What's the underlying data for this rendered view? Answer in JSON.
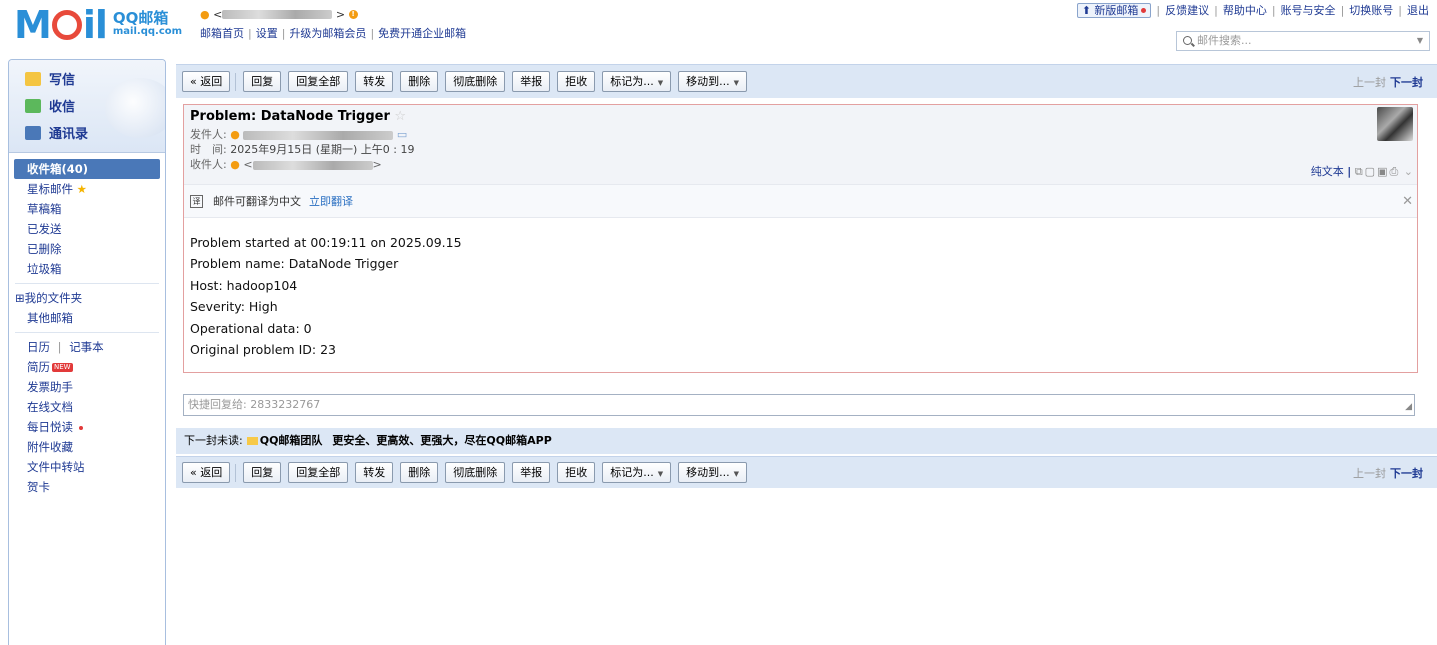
{
  "header": {
    "logo_text": "M",
    "logo_text2": "il",
    "brand_cn": "QQ邮箱",
    "brand_en": "mail.qq.com",
    "user_label": "<",
    "top_links": [
      "邮箱首页",
      "设置",
      "升级为邮箱会员",
      "免费开通企业邮箱"
    ],
    "right_links": [
      "新版邮箱",
      "反馈建议",
      "帮助中心",
      "账号与安全",
      "切换账号",
      "退出"
    ],
    "search_placeholder": "邮件搜索..."
  },
  "sidebar": {
    "compose": "写信",
    "receive": "收信",
    "contacts": "通讯录",
    "folders": [
      "收件箱(40)",
      "星标邮件",
      "草稿箱",
      "已发送",
      "已删除",
      "垃圾箱"
    ],
    "my_folders": "⊞我的文件夹",
    "other_mail": "其他邮箱",
    "calendar": "日历",
    "notes": "记事本",
    "resume": "简历",
    "resume_badge": "NEW",
    "apps": [
      "发票助手",
      "在线文档",
      "每日悦读",
      "附件收藏",
      "文件中转站",
      "贺卡"
    ]
  },
  "toolbar": {
    "back": "« 返回",
    "reply": "回复",
    "reply_all": "回复全部",
    "forward": "转发",
    "delete": "删除",
    "delete_forever": "彻底删除",
    "report": "举报",
    "reject": "拒收",
    "mark_as": "标记为...",
    "move_to": "移动到...",
    "prev": "上一封",
    "next": "下一封"
  },
  "mail": {
    "subject": "Problem: DataNode Trigger",
    "from_label": "发件人:",
    "time_label": "时　间:",
    "time_value": "2025年9月15日 (星期一) 上午0 : 19",
    "to_label": "收件人:",
    "plain_text": "纯文本",
    "translate_text": "邮件可翻译为中文",
    "translate_link": "立即翻译",
    "body_lines": [
      "Problem started at 00:19:11 on 2025.09.15",
      "Problem name: DataNode Trigger",
      "Host: hadoop104",
      "Severity: High",
      "Operational data: 0",
      "Original problem ID: 23"
    ]
  },
  "quick_reply": {
    "placeholder": "快捷回复给: 2833232767"
  },
  "next_unread": {
    "label": "下一封未读:",
    "sender": "QQ邮箱团队",
    "subject": "更安全、更高效、更强大，尽在QQ邮箱APP"
  }
}
